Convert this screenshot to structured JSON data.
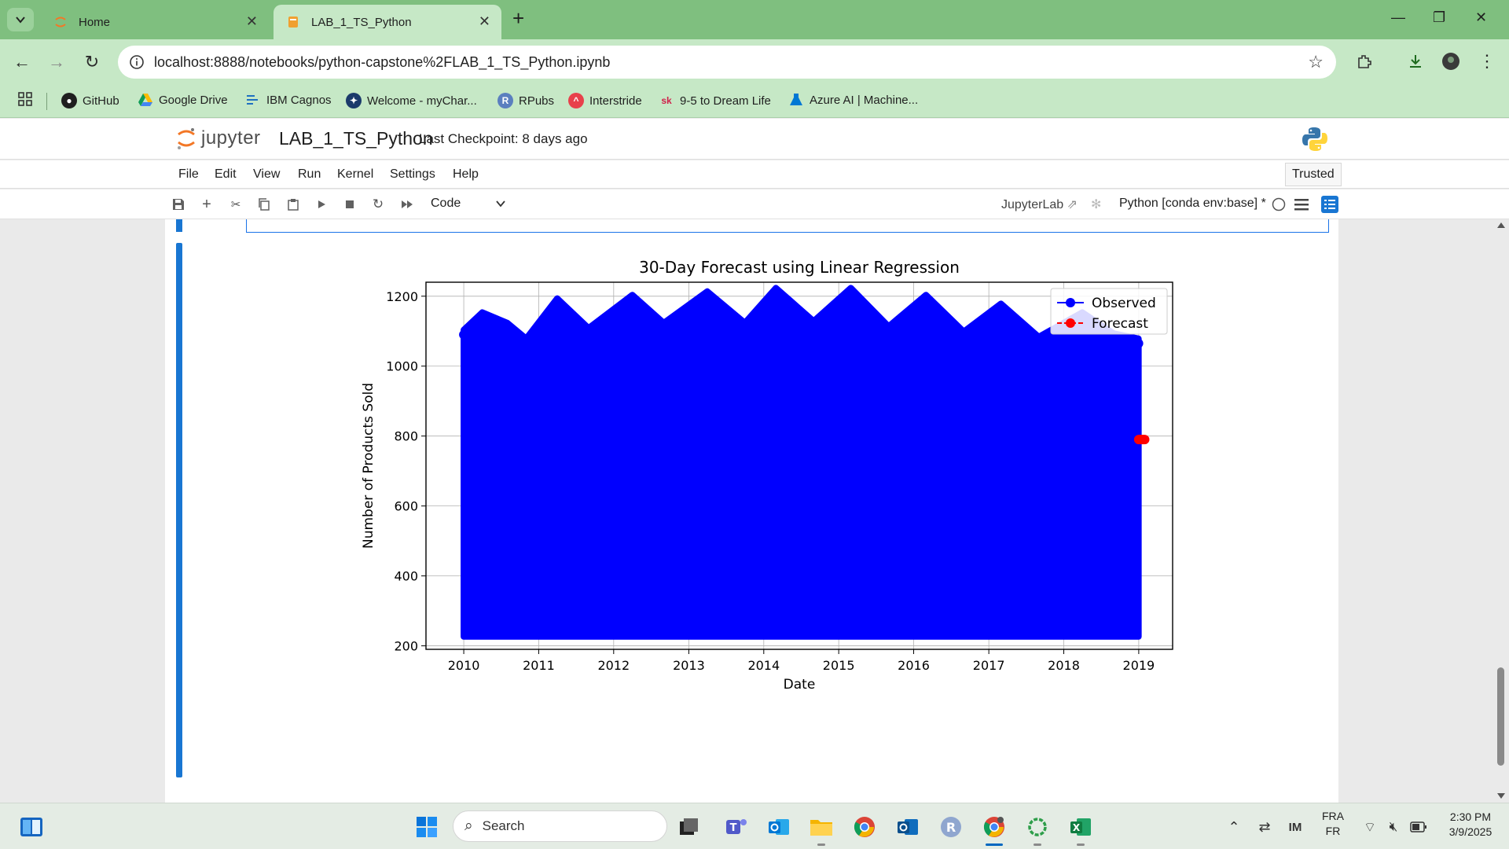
{
  "browser": {
    "tabs": [
      {
        "label": "Home",
        "active": false
      },
      {
        "label": "LAB_1_TS_Python",
        "active": true
      }
    ],
    "url": "localhost:8888/notebooks/python-capstone%2FLAB_1_TS_Python.ipynb",
    "bookmarks": [
      {
        "label": "GitHub",
        "icon": "github-icon"
      },
      {
        "label": "Google Drive",
        "icon": "google-drive-icon"
      },
      {
        "label": "IBM Cagnos",
        "icon": "ibm-cognos-icon"
      },
      {
        "label": "Welcome - myChar...",
        "icon": "mychart-icon"
      },
      {
        "label": "RPubs",
        "icon": "rpubs-icon"
      },
      {
        "label": "Interstride",
        "icon": "interstride-icon"
      },
      {
        "label": "9-5 to Dream Life",
        "icon": "sk-icon"
      },
      {
        "label": "Azure AI | Machine...",
        "icon": "azure-ml-icon"
      }
    ]
  },
  "jupyter": {
    "logo_text": "jupyter",
    "notebook_title": "LAB_1_TS_Python",
    "checkpoint": "Last Checkpoint: 8 days ago",
    "menu": [
      "File",
      "Edit",
      "View",
      "Run",
      "Kernel",
      "Settings",
      "Help"
    ],
    "trusted_label": "Trusted",
    "cell_type": "Code",
    "jupyterlab_link": "JupyterLab",
    "kernel": "Python [conda env:base] *"
  },
  "chart_data": {
    "type": "scatter",
    "title": "30-Day Forecast using Linear Regression",
    "xlabel": "Date",
    "ylabel": "Number of Products Sold",
    "x_ticks": [
      "2010",
      "2011",
      "2012",
      "2013",
      "2014",
      "2015",
      "2016",
      "2017",
      "2018",
      "2019"
    ],
    "y_ticks": [
      200,
      400,
      600,
      800,
      1000,
      1200
    ],
    "xlim": [
      "2009-07-01",
      "2019-06-15"
    ],
    "ylim": [
      190,
      1240
    ],
    "grid": true,
    "legend_position": "top-right",
    "observed_color": "#0000ff",
    "forecast_color": "#ff0000",
    "series": [
      {
        "name": "Observed",
        "marker": "o",
        "x_range": [
          "2010-01-01",
          "2018-12-31"
        ],
        "upper_envelope": [
          {
            "date": "2010-01-01",
            "value": 1090
          },
          {
            "date": "2010-04-01",
            "value": 1140
          },
          {
            "date": "2010-08-01",
            "value": 1110
          },
          {
            "date": "2010-11-01",
            "value": 1065
          },
          {
            "date": "2011-04-01",
            "value": 1180
          },
          {
            "date": "2011-09-01",
            "value": 1095
          },
          {
            "date": "2012-04-01",
            "value": 1190
          },
          {
            "date": "2012-09-01",
            "value": 1110
          },
          {
            "date": "2013-04-01",
            "value": 1200
          },
          {
            "date": "2013-10-01",
            "value": 1110
          },
          {
            "date": "2014-03-01",
            "value": 1210
          },
          {
            "date": "2014-09-01",
            "value": 1115
          },
          {
            "date": "2015-03-01",
            "value": 1210
          },
          {
            "date": "2015-09-01",
            "value": 1100
          },
          {
            "date": "2016-03-01",
            "value": 1190
          },
          {
            "date": "2016-09-01",
            "value": 1085
          },
          {
            "date": "2017-03-01",
            "value": 1165
          },
          {
            "date": "2017-09-01",
            "value": 1070
          },
          {
            "date": "2018-04-01",
            "value": 1140
          },
          {
            "date": "2018-09-01",
            "value": 1080
          },
          {
            "date": "2018-12-31",
            "value": 1065
          }
        ],
        "lower_bound": 240
      },
      {
        "name": "Forecast",
        "marker": "o",
        "x_range": [
          "2019-01-01",
          "2019-01-30"
        ],
        "values_approx": 790
      }
    ]
  },
  "taskbar": {
    "search_placeholder": "Search",
    "language_line1": "FRA",
    "language_line2": "FR",
    "time": "2:30 PM",
    "date": "3/9/2025"
  }
}
